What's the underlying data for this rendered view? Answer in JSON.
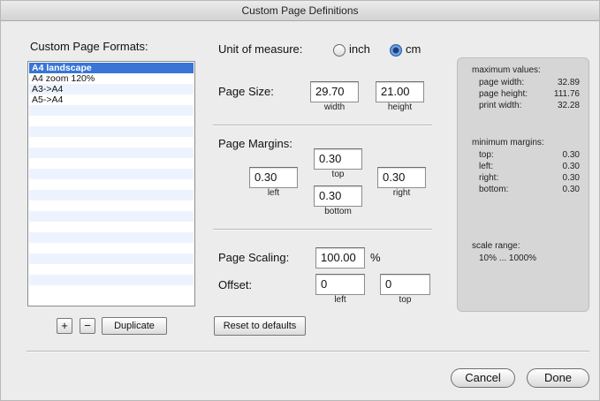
{
  "window": {
    "title": "Custom Page Definitions"
  },
  "formats": {
    "heading": "Custom Page Formats:",
    "items": [
      "A4 landscape",
      "A4 zoom 120%",
      "A3->A4",
      "A5->A4"
    ],
    "selected_index": 0,
    "add_label": "+",
    "remove_label": "−",
    "duplicate_label": "Duplicate"
  },
  "unit": {
    "label": "Unit of measure:",
    "options": [
      "inch",
      "cm"
    ],
    "selected": "cm"
  },
  "page_size": {
    "label": "Page Size:",
    "width": "29.70",
    "height": "21.00",
    "width_caption": "width",
    "height_caption": "height"
  },
  "margins": {
    "label": "Page Margins:",
    "top": "0.30",
    "left": "0.30",
    "right": "0.30",
    "bottom": "0.30",
    "top_caption": "top",
    "left_caption": "left",
    "right_caption": "right",
    "bottom_caption": "bottom"
  },
  "scaling": {
    "label": "Page Scaling:",
    "value": "100.00",
    "unit": "%",
    "offset_label": "Offset:",
    "offset_left": "0",
    "offset_top": "0",
    "offset_left_caption": "left",
    "offset_top_caption": "top"
  },
  "reset_label": "Reset to defaults",
  "info": {
    "max_heading": "maximum values:",
    "page_width_label": "page width:",
    "page_width": "32.89",
    "page_height_label": "page height:",
    "page_height": "111.76",
    "print_width_label": "print width:",
    "print_width": "32.28",
    "min_heading": "minimum margins:",
    "top_label": "top:",
    "top": "0.30",
    "left_label": "left:",
    "left": "0.30",
    "right_label": "right:",
    "right": "0.30",
    "bottom_label": "bottom:",
    "bottom": "0.30",
    "scale_heading": "scale range:",
    "scale_range": "10% ... 1000%"
  },
  "footer": {
    "cancel_label": "Cancel",
    "done_label": "Done"
  },
  "colors": {
    "selection": "#3875d7",
    "stripe": "#edf3fe",
    "infobox": "#d6d6d6"
  }
}
